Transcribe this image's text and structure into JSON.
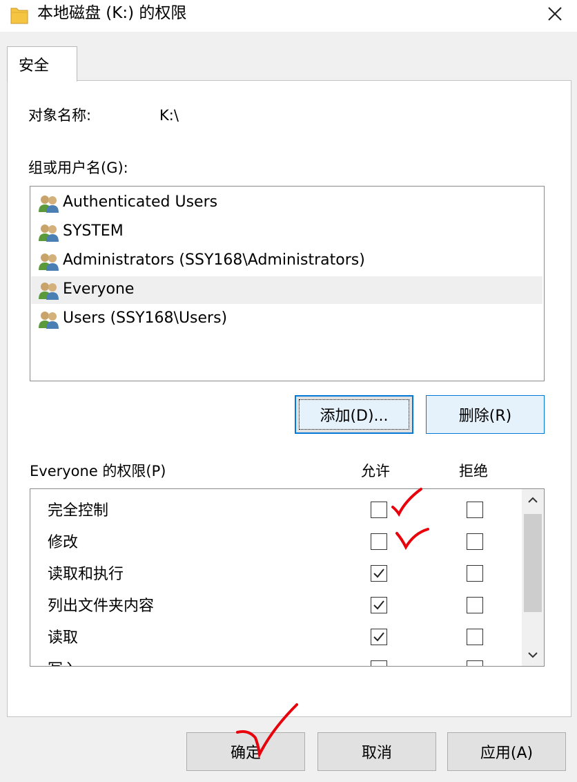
{
  "window": {
    "title": "本地磁盘 (K:) 的权限"
  },
  "tabs": [
    {
      "label": "安全"
    }
  ],
  "object": {
    "label": "对象名称:",
    "value": "K:\\"
  },
  "groups": {
    "label": "组或用户名(G):",
    "items": [
      {
        "label": "Authenticated Users",
        "selected": false
      },
      {
        "label": "SYSTEM",
        "selected": false
      },
      {
        "label": "Administrators (SSY168\\Administrators)",
        "selected": false
      },
      {
        "label": "Everyone",
        "selected": true
      },
      {
        "label": "Users (SSY168\\Users)",
        "selected": false
      }
    ]
  },
  "buttons": {
    "add": "添加(D)...",
    "remove": "删除(R)",
    "ok": "确定",
    "cancel": "取消",
    "apply": "应用(A)"
  },
  "permissions": {
    "label": "Everyone 的权限(P)",
    "allow_header": "允许",
    "deny_header": "拒绝",
    "items": [
      {
        "label": "完全控制",
        "allow": false,
        "deny": false
      },
      {
        "label": "修改",
        "allow": false,
        "deny": false
      },
      {
        "label": "读取和执行",
        "allow": true,
        "deny": false
      },
      {
        "label": "列出文件夹内容",
        "allow": true,
        "deny": false
      },
      {
        "label": "读取",
        "allow": true,
        "deny": false
      },
      {
        "label": "写入",
        "allow": false,
        "deny": false
      }
    ]
  },
  "colors": {
    "accent": "#0078d7",
    "annotation": "#e8000b",
    "selection": "#efefef",
    "folder": "#f5c542"
  },
  "icons": {
    "window": "folder-icon",
    "close": "close-icon",
    "user": "user-group-icon"
  }
}
